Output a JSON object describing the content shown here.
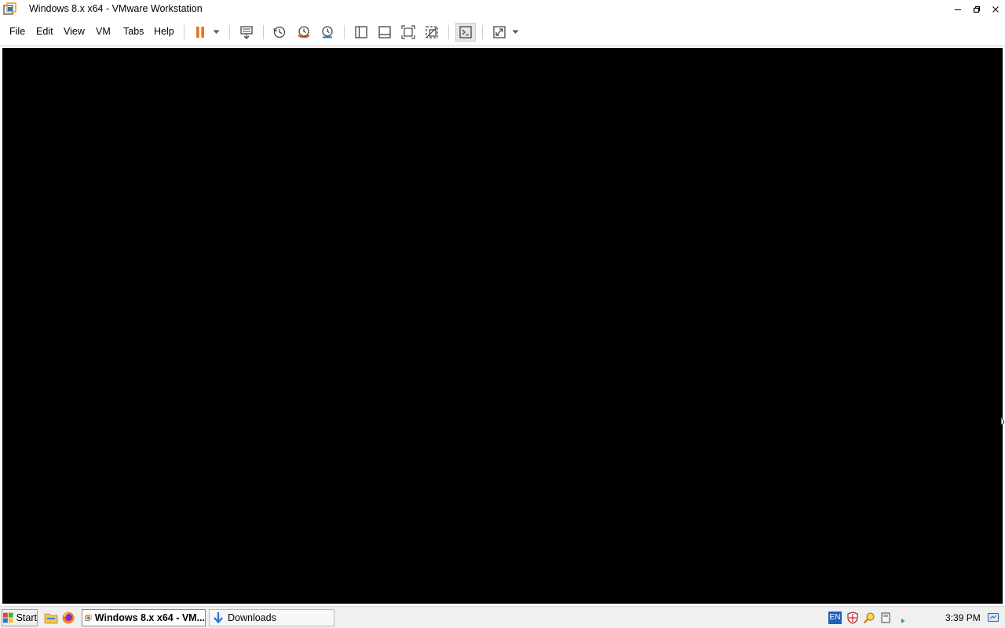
{
  "window": {
    "title": "Windows 8.x x64 - VMware Workstation",
    "controls": [
      "minimize-icon",
      "maximize-icon",
      "close-icon"
    ]
  },
  "menubar": {
    "items": [
      {
        "label": "File"
      },
      {
        "label": "Edit"
      },
      {
        "label": "View"
      },
      {
        "label": "VM"
      },
      {
        "label": "Tabs"
      },
      {
        "label": "Help"
      }
    ]
  },
  "toolbar": {
    "icons": [
      "pause-icon",
      "dropdown-arrow-icon",
      "send-ctrl-alt-del-icon",
      "snapshot-icon",
      "revert-snapshot-icon",
      "snapshot-manager-icon",
      "show-library-icon",
      "show-thumbnail-bar-icon",
      "full-screen-icon",
      "unity-icon",
      "console-view-icon",
      "stretch-guest-icon",
      "dropdown-arrow-icon"
    ],
    "pause_color": "#e8711a"
  },
  "vm_display": {
    "background": "#000000"
  },
  "taskbar": {
    "start_label": "Start",
    "tasks": [
      {
        "label": "Windows 8.x x64 - VM...",
        "active": true,
        "icon": "vmware-icon"
      },
      {
        "label": "Downloads",
        "active": false,
        "icon": "download-arrow-icon"
      }
    ],
    "tray": {
      "language": "EN",
      "clock": "3:39 PM"
    }
  }
}
